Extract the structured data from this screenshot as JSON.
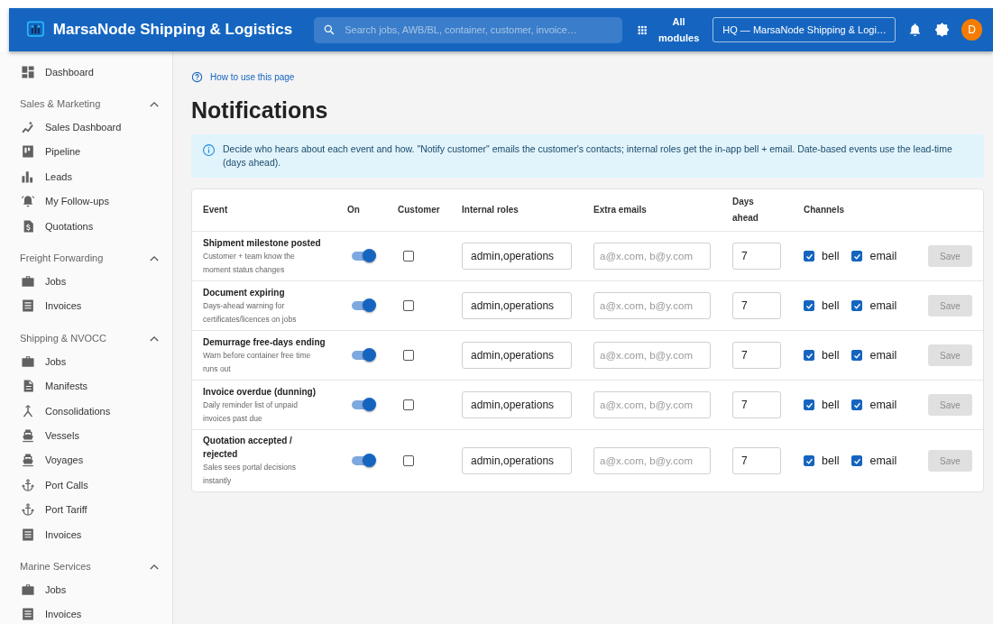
{
  "app": {
    "title": "MarsaNode Shipping & Logistics",
    "search_placeholder": "Search jobs, AWB/BL, container, customer, invoice…",
    "modules_label": "All modules",
    "org_select": "HQ — MarsaNode Shipping & Logi…",
    "avatar_initial": "D"
  },
  "sidebar": {
    "top_item": {
      "label": "Dashboard"
    },
    "sections": [
      {
        "title": "Sales & Marketing",
        "expanded": true,
        "items": [
          {
            "label": "Sales Dashboard"
          },
          {
            "label": "Pipeline"
          },
          {
            "label": "Leads"
          },
          {
            "label": "My Follow-ups"
          },
          {
            "label": "Quotations"
          }
        ]
      },
      {
        "title": "Freight Forwarding",
        "expanded": true,
        "items": [
          {
            "label": "Jobs"
          },
          {
            "label": "Invoices"
          }
        ]
      },
      {
        "title": "Shipping & NVOCC",
        "expanded": true,
        "items": [
          {
            "label": "Jobs"
          },
          {
            "label": "Manifests"
          },
          {
            "label": "Consolidations"
          },
          {
            "label": "Vessels"
          },
          {
            "label": "Voyages"
          },
          {
            "label": "Port Calls"
          },
          {
            "label": "Port Tariff"
          },
          {
            "label": "Invoices"
          }
        ]
      },
      {
        "title": "Marine Services",
        "expanded": true,
        "items": [
          {
            "label": "Jobs"
          },
          {
            "label": "Invoices"
          }
        ]
      }
    ]
  },
  "help_link": "How to use this page",
  "page_title": "Notifications",
  "info": "Decide who hears about each event and how. \"Notify customer\" emails the customer's contacts; internal roles get the in-app bell + email. Date-based events use the lead-time (days ahead).",
  "table": {
    "columns": [
      "Event",
      "On",
      "Customer",
      "Internal roles",
      "Extra emails",
      "Days ahead",
      "Channels"
    ],
    "rows": [
      {
        "event": "Shipment milestone posted",
        "description": "Customer + team know the moment status changes",
        "on": true,
        "customer": false,
        "roles": "admin,operations",
        "emails_placeholder": "a@x.com, b@y.com",
        "days": "7",
        "bell": true,
        "bell_label": "bell",
        "email": true,
        "email_label": "email",
        "save": "Save",
        "save_disabled": true
      },
      {
        "event": "Document expiring",
        "description": "Days-ahead warning for certificates/licences on jobs",
        "on": true,
        "customer": false,
        "roles": "admin,operations",
        "emails_placeholder": "a@x.com, b@y.com",
        "days": "7",
        "bell": true,
        "bell_label": "bell",
        "email": true,
        "email_label": "email",
        "save": "Save",
        "save_disabled": true
      },
      {
        "event": "Demurrage free-days ending",
        "description": "Warn before container free time runs out",
        "on": true,
        "customer": false,
        "roles": "admin,operations",
        "emails_placeholder": "a@x.com, b@y.com",
        "days": "7",
        "bell": true,
        "bell_label": "bell",
        "email": true,
        "email_label": "email",
        "save": "Save",
        "save_disabled": true
      },
      {
        "event": "Invoice overdue (dunning)",
        "description": "Daily reminder list of unpaid invoices past due",
        "on": true,
        "customer": false,
        "roles": "admin,operations",
        "emails_placeholder": "a@x.com, b@y.com",
        "days": "7",
        "bell": true,
        "bell_label": "bell",
        "email": true,
        "email_label": "email",
        "save": "Save",
        "save_disabled": true
      },
      {
        "event": "Quotation accepted / rejected",
        "description": "Sales sees portal decisions instantly",
        "on": true,
        "customer": false,
        "roles": "admin,operations",
        "emails_placeholder": "a@x.com, b@y.com",
        "days": "7",
        "bell": true,
        "bell_label": "bell",
        "email": true,
        "email_label": "email",
        "save": "Save",
        "save_disabled": true
      }
    ]
  }
}
